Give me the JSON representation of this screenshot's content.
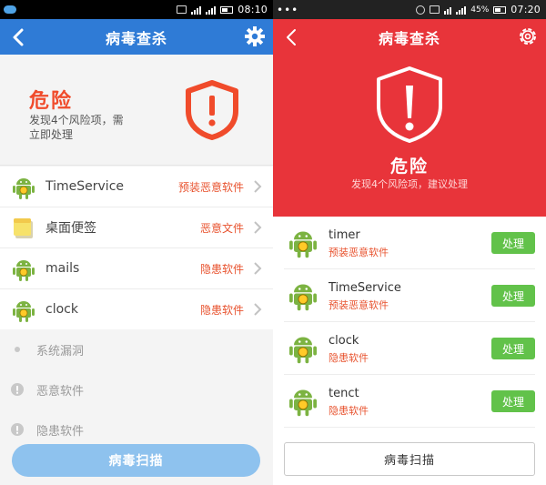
{
  "left": {
    "status": {
      "time": "08:10"
    },
    "appbar": {
      "title": "病毒查杀"
    },
    "danger": {
      "label": "危险",
      "desc": "发现4个风险项，需立即处理"
    },
    "threats": [
      {
        "name": "TimeService",
        "type": "预装恶意软件",
        "icon": "android-icon"
      },
      {
        "name": "桌面便签",
        "type": "恶意文件",
        "icon": "note-icon"
      },
      {
        "name": "mails",
        "type": "隐患软件",
        "icon": "android-icon"
      },
      {
        "name": "clock",
        "type": "隐患软件",
        "icon": "android-icon"
      }
    ],
    "categories": [
      {
        "label": "系统漏洞",
        "icon": "dot-icon"
      },
      {
        "label": "恶意软件",
        "icon": "alert-icon"
      },
      {
        "label": "隐患软件",
        "icon": "alert-icon"
      }
    ],
    "scan_label": "病毒扫描"
  },
  "right": {
    "status": {
      "time": "07:20",
      "battery": "45%"
    },
    "appbar": {
      "title": "病毒查杀"
    },
    "danger": {
      "label": "危险",
      "desc": "发现4个风险项，建议处理"
    },
    "threats": [
      {
        "name": "timer",
        "type": "预装恶意软件",
        "action": "处理",
        "icon": "android-icon"
      },
      {
        "name": "TimeService",
        "type": "预装恶意软件",
        "action": "处理",
        "icon": "android-icon"
      },
      {
        "name": "clock",
        "type": "隐患软件",
        "action": "处理",
        "icon": "android-icon"
      },
      {
        "name": "tenct",
        "type": "隐患软件",
        "action": "处理",
        "icon": "android-icon"
      }
    ],
    "scan_label": "病毒扫描"
  },
  "colors": {
    "blue": "#2f7bd6",
    "red": "#e8343a",
    "green": "#62c24a",
    "warn": "#e8532f"
  }
}
